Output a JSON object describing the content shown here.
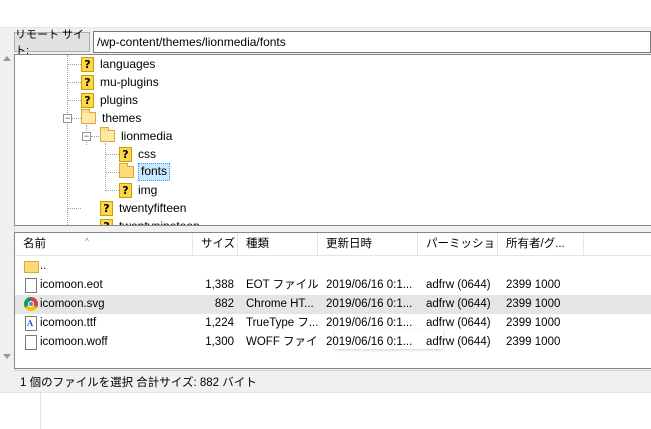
{
  "address": {
    "label": "リモート サイト:",
    "path": "/wp-content/themes/lionmedia/fonts"
  },
  "tree": {
    "items": [
      {
        "label": "languages",
        "icon": "question-folder-icon",
        "selected": false
      },
      {
        "label": "mu-plugins",
        "icon": "question-folder-icon",
        "selected": false
      },
      {
        "label": "plugins",
        "icon": "question-folder-icon",
        "selected": false
      },
      {
        "label": "themes",
        "icon": "open-folder-icon",
        "selected": false
      },
      {
        "label": "lionmedia",
        "icon": "open-folder-icon",
        "selected": false
      },
      {
        "label": "css",
        "icon": "question-folder-icon",
        "selected": false
      },
      {
        "label": "fonts",
        "icon": "folder-icon",
        "selected": true
      },
      {
        "label": "img",
        "icon": "question-folder-icon",
        "selected": false
      },
      {
        "label": "twentyfifteen",
        "icon": "question-folder-icon",
        "selected": false
      },
      {
        "label": "twentynineteen",
        "icon": "question-folder-icon",
        "selected": false
      }
    ],
    "expander_minus": "−"
  },
  "list": {
    "columns": [
      "名前",
      "サイズ",
      "種類",
      "更新日時",
      "パーミッション",
      "所有者/グ..."
    ],
    "sort_indicator": "^",
    "rows": [
      {
        "name": "..",
        "size": "",
        "type": "",
        "modified": "",
        "perm": "",
        "owner": "",
        "icon": "folder-icon"
      },
      {
        "name": "icomoon.eot",
        "size": "1,388",
        "type": "EOT ファイル",
        "modified": "2019/06/16 0:1...",
        "perm": "adfrw (0644)",
        "owner": "2399 1000",
        "icon": "file-icon"
      },
      {
        "name": "icomoon.svg",
        "size": "882",
        "type": "Chrome HT...",
        "modified": "2019/06/16 0:1...",
        "perm": "adfrw (0644)",
        "owner": "2399 1000",
        "icon": "chrome-icon"
      },
      {
        "name": "icomoon.ttf",
        "size": "1,224",
        "type": "TrueType フ...",
        "modified": "2019/06/16 0:1...",
        "perm": "adfrw (0644)",
        "owner": "2399 1000",
        "icon": "font-file-icon"
      },
      {
        "name": "icomoon.woff",
        "size": "1,300",
        "type": "WOFF ファイ...",
        "modified": "2019/06/16 0:1...",
        "perm": "adfrw (0644)",
        "owner": "2399 1000",
        "icon": "file-icon"
      }
    ],
    "selected_row": 2
  },
  "status": {
    "text": "1 個のファイルを選択 合計サイズ: 882 バイト"
  },
  "colors": {
    "selection": "#cce8ff",
    "selected_row": "#e5e5e5",
    "folder": "#ffd97a",
    "question": "#ffd54a"
  }
}
